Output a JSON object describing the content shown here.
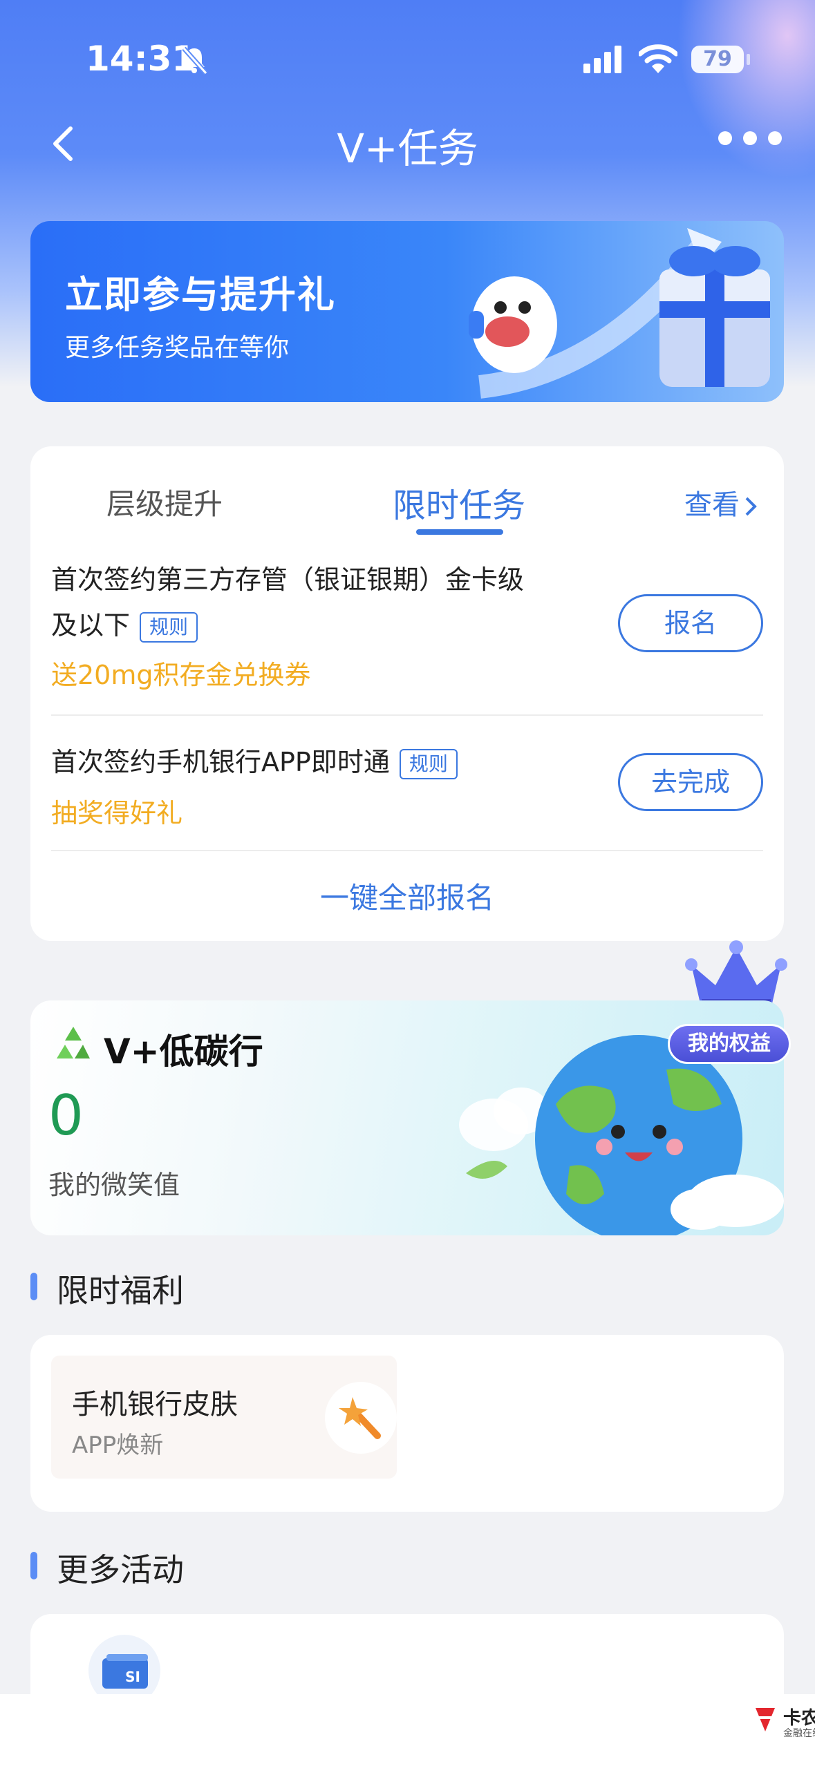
{
  "status_bar": {
    "time": "14:31",
    "battery": "79"
  },
  "nav": {
    "title": "V+任务"
  },
  "banner": {
    "title": "立即参与提升礼",
    "subtitle": "更多任务奖品在等你"
  },
  "task_card": {
    "tabs": [
      {
        "label": "层级提升"
      },
      {
        "label": "限时任务"
      }
    ],
    "view_label": "查看",
    "tasks": [
      {
        "name_line1": "首次签约第三方存管（银证银期）金卡级",
        "name_line2": "及以下",
        "rule_label": "规则",
        "reward": "送20mg积存金兑换券",
        "action": "报名"
      },
      {
        "name_line1": "首次签约手机银行APP即时通",
        "rule_label": "规则",
        "reward": "抽奖得好礼",
        "action": "去完成"
      }
    ],
    "sign_all": "一键全部报名"
  },
  "carbon": {
    "title": "V+低碳行",
    "value": "0",
    "label": "我的微笑值",
    "rights_badge": "我的权益"
  },
  "welfare": {
    "section_title": "限时福利",
    "item": {
      "name": "手机银行皮肤",
      "subtitle": "APP焕新"
    }
  },
  "activities": {
    "section_title": "更多活动"
  },
  "watermark": {
    "title": "卡农社区",
    "subtitle": "金融在线教育"
  },
  "colors": {
    "accent": "#3b78e0",
    "reward": "#f2ac22",
    "green": "#1f9a54"
  }
}
